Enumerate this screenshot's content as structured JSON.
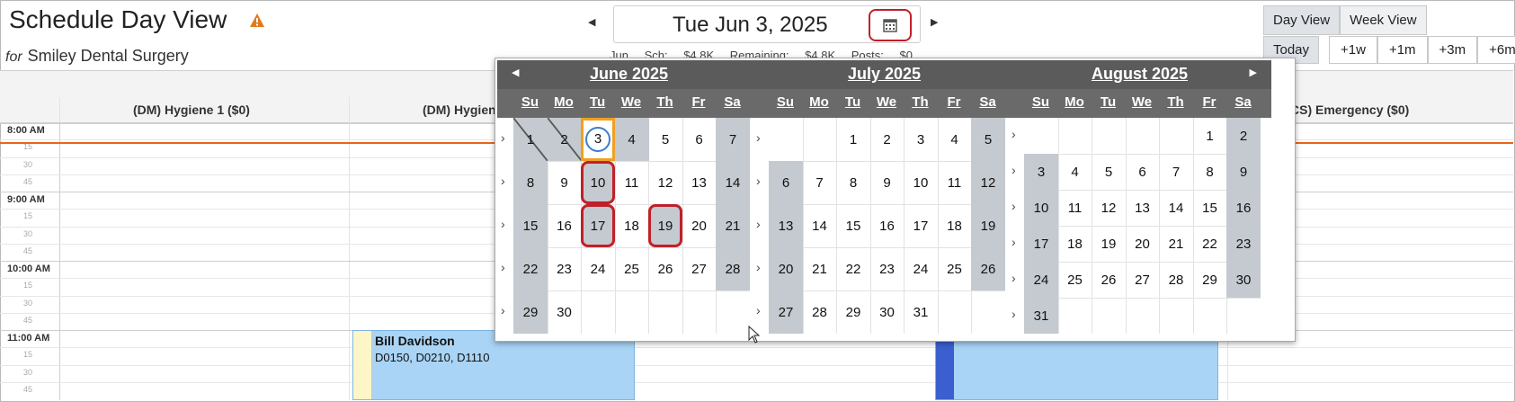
{
  "header": {
    "title": "Schedule Day View",
    "for_label": "for",
    "practice": "Smiley Dental Surgery",
    "date": "Tue Jun 3, 2025",
    "summary": "Jun     Sch: $4.8K     Remaining: $4.8K     Posts: $0"
  },
  "view_buttons": {
    "day": "Day View",
    "week": "Week View",
    "today": "Today"
  },
  "jumps": [
    "+1w",
    "+1m",
    "+3m",
    "+6m"
  ],
  "columns": [
    "(DM) Hygiene 1 ($0)",
    "(DM) Hygiene",
    "CS) Emergency ($0)"
  ],
  "times": {
    "hours": [
      "8:00 AM",
      "9:00 AM",
      "10:00 AM",
      "11:00 AM"
    ],
    "minutes": [
      "15",
      "30",
      "45"
    ]
  },
  "appointment": {
    "name": "Bill Davidson",
    "codes": "D0150, D0210, D1110"
  },
  "weekdays": [
    "Su",
    "Mo",
    "Tu",
    "We",
    "Th",
    "Fr",
    "Sa"
  ],
  "months": [
    {
      "title": "June 2025",
      "weeks": [
        [
          "1",
          "2",
          "3",
          "4",
          "5",
          "6",
          "7"
        ],
        [
          "8",
          "9",
          "10",
          "11",
          "12",
          "13",
          "14"
        ],
        [
          "15",
          "16",
          "17",
          "18",
          "19",
          "20",
          "21"
        ],
        [
          "22",
          "23",
          "24",
          "25",
          "26",
          "27",
          "28"
        ],
        [
          "29",
          "30",
          "",
          "",
          "",
          "",
          ""
        ]
      ]
    },
    {
      "title": "July 2025",
      "weeks": [
        [
          "",
          "",
          "1",
          "2",
          "3",
          "4",
          "5"
        ],
        [
          "6",
          "7",
          "8",
          "9",
          "10",
          "11",
          "12"
        ],
        [
          "13",
          "14",
          "15",
          "16",
          "17",
          "18",
          "19"
        ],
        [
          "20",
          "21",
          "22",
          "23",
          "24",
          "25",
          "26"
        ],
        [
          "27",
          "28",
          "29",
          "30",
          "31",
          "",
          ""
        ]
      ]
    },
    {
      "title": "August 2025",
      "weeks": [
        [
          "",
          "",
          "",
          "",
          "",
          "1",
          "2"
        ],
        [
          "3",
          "4",
          "5",
          "6",
          "7",
          "8",
          "9"
        ],
        [
          "10",
          "11",
          "12",
          "13",
          "14",
          "15",
          "16"
        ],
        [
          "17",
          "18",
          "19",
          "20",
          "21",
          "22",
          "23"
        ],
        [
          "24",
          "25",
          "26",
          "27",
          "28",
          "29",
          "30"
        ],
        [
          "31",
          "",
          "",
          "",
          "",
          "",
          ""
        ]
      ]
    }
  ],
  "icons": {
    "warning": "warning-icon",
    "calendar": "calendar-icon",
    "prev": "chevron-left-icon",
    "next": "chevron-right-icon"
  },
  "colors": {
    "now_line": "#e8651a",
    "highlight": "#c0202a",
    "selected_border": "#f0a020",
    "appointment": "#a9d4f5"
  }
}
